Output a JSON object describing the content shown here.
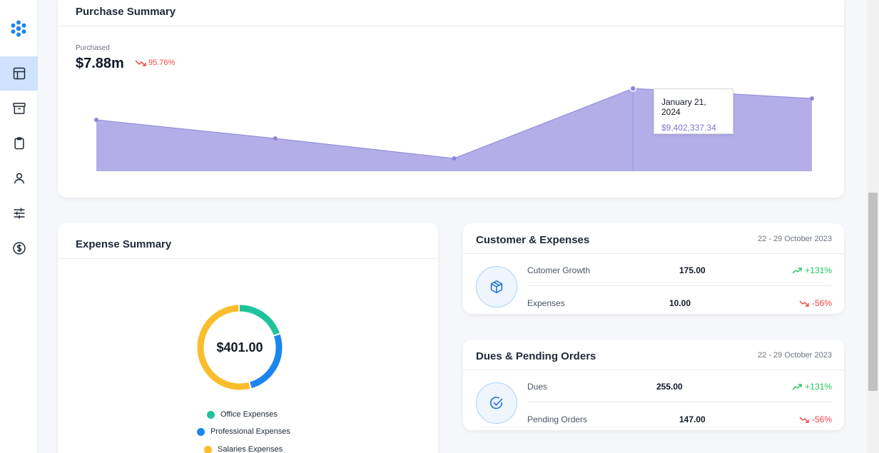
{
  "purchase_summary": {
    "title": "Purchase Summary",
    "label": "Purchased",
    "value": "$7.88m",
    "change": "95.76%",
    "tooltip": {
      "date": "January 21, 2024",
      "value": "$9,402,337.34"
    },
    "colors": {
      "area": "#b3aee8",
      "line": "#8c86d9"
    }
  },
  "chart_data": {
    "type": "area",
    "title": "",
    "xlabel": "",
    "ylabel": "",
    "series": [
      {
        "values": [
          7200000,
          5900000,
          4500000,
          9402337.34,
          8700000
        ]
      }
    ],
    "ylim": [
      3600000,
      10300000
    ],
    "grid": false,
    "highlight_index": 3
  },
  "expense_summary": {
    "title": "Expense Summary",
    "total": "$401.00",
    "segments": [
      {
        "name": "Office Expenses",
        "fraction": 0.2,
        "color": "#1fc39a"
      },
      {
        "name": "Professional Expenses",
        "fraction": 0.26,
        "color": "#1c86ee"
      },
      {
        "name": "Salaries Expenses",
        "fraction": 0.54,
        "color": "#fbbd2c"
      }
    ]
  },
  "customer_expenses": {
    "title": "Customer & Expenses",
    "period": "22 - 29 October 2023",
    "icon": "box-icon",
    "rows": [
      {
        "label": "Cutomer Growth",
        "value": "175.00",
        "change": "+131%",
        "trend": "up"
      },
      {
        "label": "Expenses",
        "value": "10.00",
        "change": "-56%",
        "trend": "down"
      }
    ]
  },
  "dues_pending": {
    "title": "Dues & Pending Orders",
    "period": "22 - 29 October 2023",
    "icon": "check-circle-icon",
    "rows": [
      {
        "label": "Dues",
        "value": "255.00",
        "change": "+131%",
        "trend": "up"
      },
      {
        "label": "Pending Orders",
        "value": "147.00",
        "change": "-56%",
        "trend": "down"
      }
    ]
  },
  "sidebar": {
    "items": [
      {
        "icon": "layout-icon",
        "active": true
      },
      {
        "icon": "archive-icon",
        "active": false
      },
      {
        "icon": "clipboard-icon",
        "active": false
      },
      {
        "icon": "user-icon",
        "active": false
      },
      {
        "icon": "sliders-icon",
        "active": false
      },
      {
        "icon": "dollar-circle-icon",
        "active": false
      }
    ]
  }
}
